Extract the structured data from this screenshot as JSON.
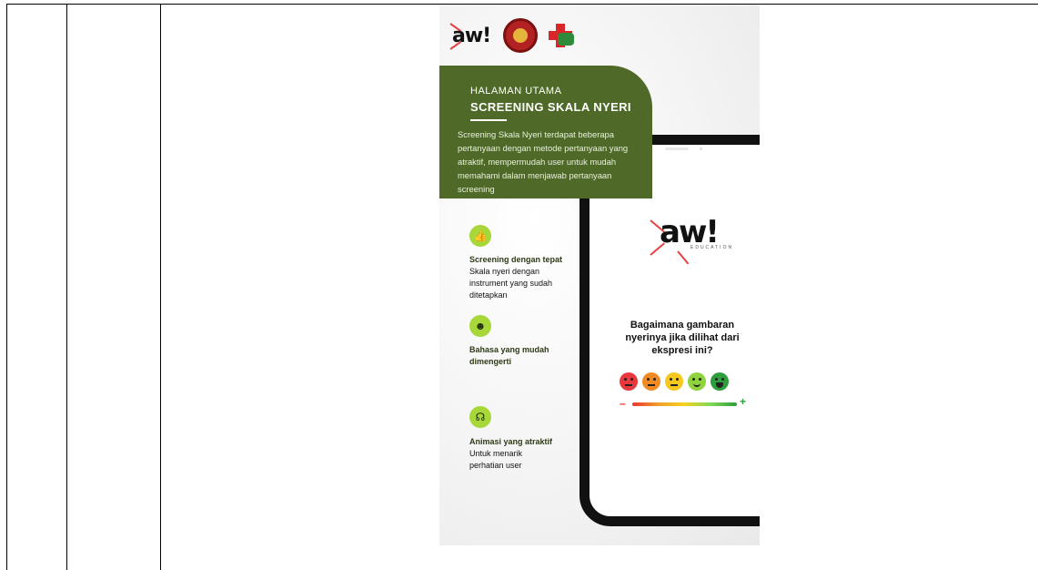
{
  "poster": {
    "logos": {
      "aw_logo": "aw!",
      "seal_icon": "university-seal-icon",
      "hospital_icon": "hospital-cross-icon"
    },
    "card": {
      "subtitle": "HALAMAN UTAMA",
      "title": "SCREENING SKALA NYERI",
      "body": "Screening Skala Nyeri terdapat beberapa pertanyaan dengan metode pertanyaan yang atraktif, mempermudah user untuk mudah memahami dalam menjawab pertanyaan screening"
    },
    "features": [
      {
        "icon": "thumbs-up-icon",
        "title": "Screening dengan tepat",
        "desc": "Skala nyeri dengan instrument yang sudah ditetapkan"
      },
      {
        "icon": "user-circle-icon",
        "title": "Bahasa yang mudah dimengerti",
        "desc": ""
      },
      {
        "icon": "headset-icon",
        "title": "Animasi yang atraktif",
        "desc": "Untuk menarik perhatian user"
      }
    ],
    "phone": {
      "logo": "aw!",
      "logo_sub": "EDUCATION",
      "question": "Bagaimana gambaran nyerinya jika dilihat dari ekspresi ini?",
      "scale_minus": "–",
      "scale_plus": "+",
      "faces": [
        {
          "name": "very-sad-face-icon",
          "color": "#e8373d"
        },
        {
          "name": "sad-face-icon",
          "color": "#f08a24"
        },
        {
          "name": "neutral-face-icon",
          "color": "#f5c81f"
        },
        {
          "name": "smile-face-icon",
          "color": "#8fd43c"
        },
        {
          "name": "happy-face-icon",
          "color": "#2e9d3b"
        }
      ]
    },
    "colors": {
      "card_green": "#4f6a28",
      "icon_green": "#a8d73a"
    }
  }
}
